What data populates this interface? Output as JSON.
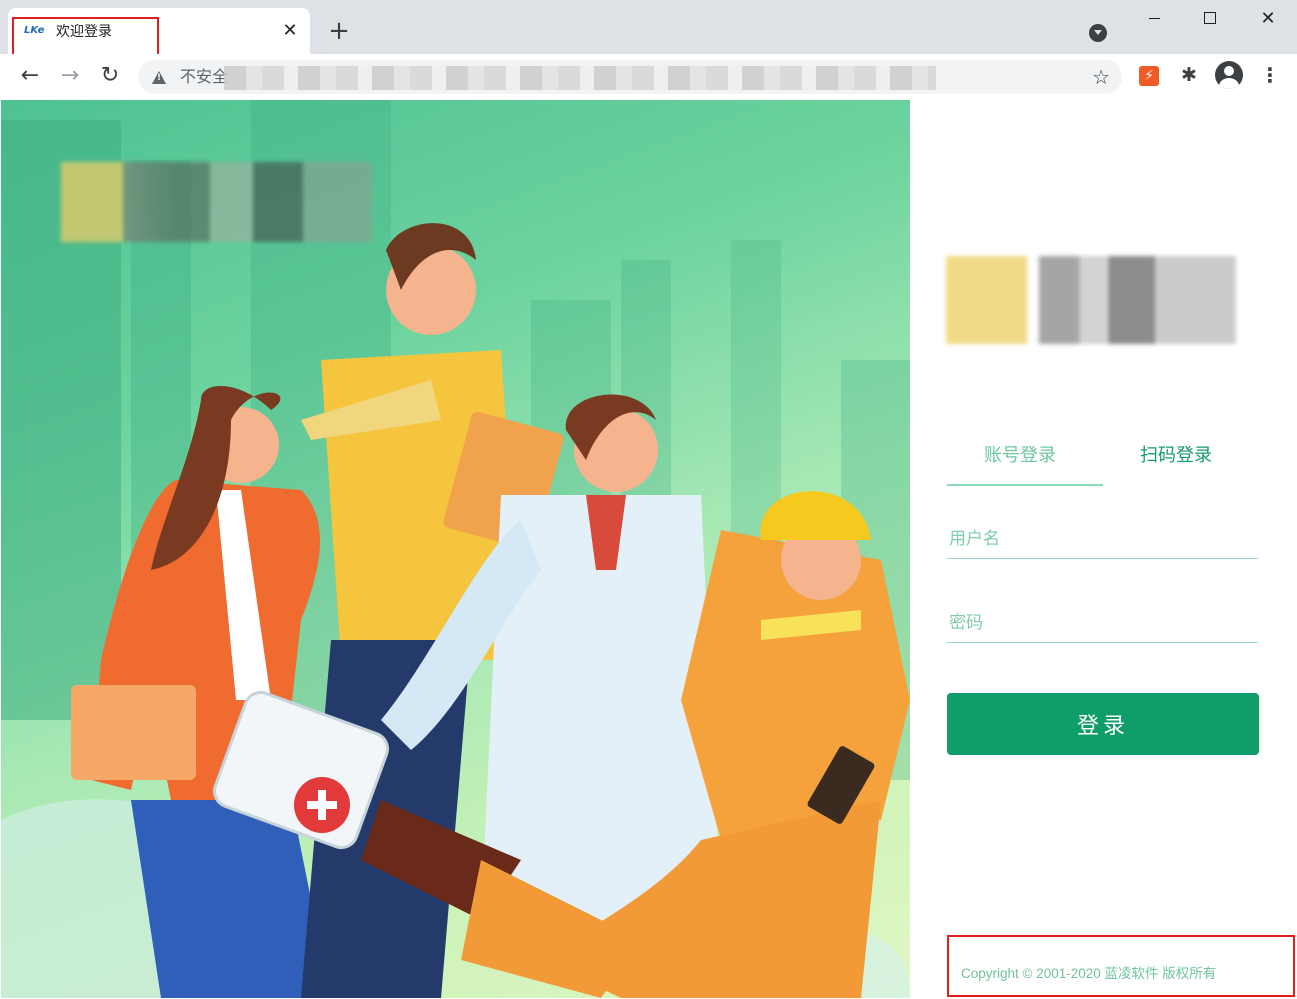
{
  "browser": {
    "tab": {
      "title": "欢迎登录",
      "favicon_text": "LKe"
    },
    "new_tab_symbol": "+",
    "close_tab_symbol": "✕",
    "window_close_symbol": "✕",
    "address_bar": {
      "security_label": "不安全",
      "url": ""
    },
    "icons": [
      "back-icon",
      "forward-icon",
      "reload-icon",
      "star-icon",
      "extension-icon",
      "puzzle-icon",
      "profile-icon",
      "menu-icon"
    ],
    "nav": {
      "back": "←",
      "forward": "→",
      "reload": "↻",
      "star": "☆",
      "ext": "⚡",
      "puzzle": "✱",
      "menu": "⋮"
    }
  },
  "login": {
    "tabs": [
      "账号登录",
      "扫码登录"
    ],
    "active_tab": "账号登录",
    "username_placeholder": "用户名",
    "username_value": "",
    "password_placeholder": "密码",
    "password_value": "",
    "submit_label": "登录"
  },
  "footer": {
    "copyright": "Copyright © 2001-2020 蓝凌软件 版权所有"
  },
  "colors": {
    "primary": "#0f9d6a",
    "accent": "#6cc8a0",
    "annotation": "#e02020"
  }
}
